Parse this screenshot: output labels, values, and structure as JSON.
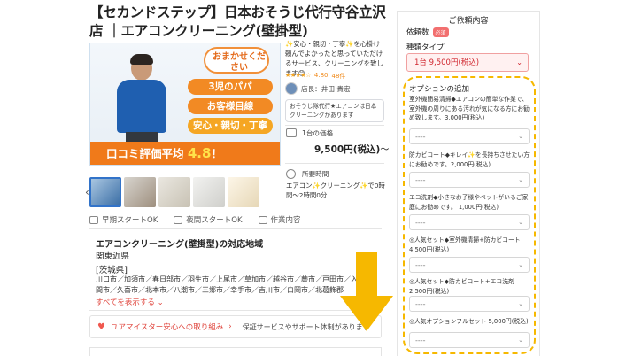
{
  "title": "【セカンドステップ】日本おそうじ代行守谷立沢店 ｜エアコンクリーニング(壁掛型)",
  "hero": {
    "bubble": "おまかせください",
    "pill1": "3児のパパ",
    "pill2": "お客様目線",
    "pill3": "安心・親切・丁寧",
    "banner_prefix": "口コミ評価平均",
    "banner_value": "4.8",
    "banner_suffix": "！"
  },
  "thumb_prev": "‹",
  "features": [
    "早期スタートOK",
    "夜間スタートOK",
    "作業内容"
  ],
  "description": "✨安心・親切・丁寧✨を心掛け頼んでよかったと思っていただけるサービス、クリーニングを致します😊",
  "rating": {
    "stars": "★★★★☆",
    "score": "4.80",
    "count": "48件"
  },
  "shop": {
    "label": "店長：井田 貴宏"
  },
  "note": "おそうじ隊代行★エアコンは日本クリーニングがあります",
  "price_label": "1台の価格",
  "price_value": "9,500円(税込)",
  "price_tail": "〜",
  "duration_label": "所要時間",
  "duration_text": "エアコン✨クリーニング✨で0時間〜2時間0分",
  "area": {
    "title": "エアコンクリーニング(壁掛型)の対応地域",
    "region": "関東近県",
    "pref": "[茨城県]",
    "cities": "川口市／加須市／春日部市／羽生市／上尾市／草加市／越谷市／蕨市／戸田市／入間市／久喜市／北本市／八潮市／三郷市／幸手市／吉川市／白岡市／北葛飾郡",
    "show_all": "すべてを表示する ⌄"
  },
  "safety": {
    "link": "ユアマイスター安心への取り組み",
    "chev": "›",
    "note": "保証サービスやサポート体制があります"
  },
  "panel": {
    "title": "ご依頼内容",
    "req_label": "依頼数",
    "req_badge": "必須",
    "plan_label": "種類タイプ",
    "plan_value": "1台 9,500円(税込)",
    "options_title": "オプションの追加",
    "options": [
      {
        "desc": "室外機簡易清掃◆エアコンの簡単な作業で、室外機の周りにある汚れが気になる方にお勧め致します。3,000円(税込)",
        "value": "----"
      },
      {
        "desc": "防カビコート◆キレイ✨を長持ちさせたい方にお勧めです。2,000円(税込)",
        "value": "----"
      },
      {
        "desc": "エコ洗剤◆小さなお子様やペットがいるご家庭にお勧めです。 1,000円(税込)",
        "value": "----"
      },
      {
        "desc": "◎人気セット◆室外機清掃+防カビコート 4,500円(税込)",
        "value": "----"
      },
      {
        "desc": "◎人気セット◆防カビコート+エコ洗剤 2,500円(税込)",
        "value": "----"
      },
      {
        "desc": "◎人気オプションフルセット 5,000円(税込)",
        "value": "----"
      }
    ]
  },
  "icons": {
    "chevron": "chevron-down-icon",
    "arrow": "down-arrow-icon"
  },
  "colors": {
    "accent_red": "#d0262e",
    "arrow_yellow": "#f6b800",
    "banner_orange": "#f07a1a"
  }
}
